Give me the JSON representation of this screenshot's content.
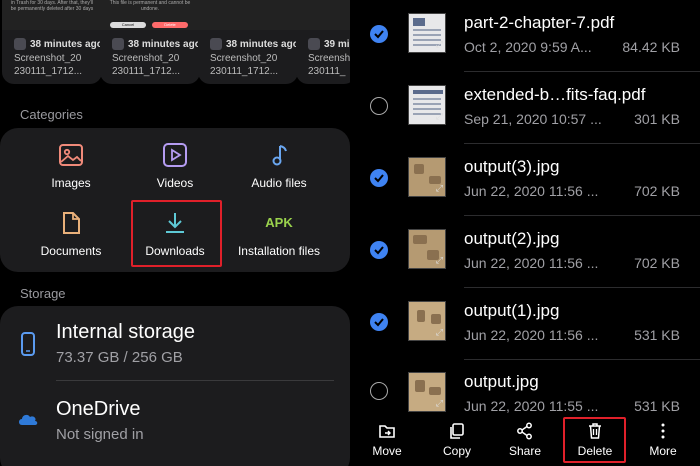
{
  "recent": {
    "cards": [
      {
        "message": "in Trash for 30 days. After that, they'll be permanently deleted after 30 days",
        "time": "38 minutes ago",
        "name": "Screenshot_20\n230111_1712..."
      },
      {
        "message": "This file is permanent and cannot be undone.",
        "cancel": "Cancel",
        "delete": "Delete",
        "time": "38 minutes ago",
        "name": "Screenshot_20\n230111_1712..."
      },
      {
        "message": "",
        "time": "38 minutes ago",
        "name": "Screenshot_20\n230111_1712..."
      },
      {
        "message": "",
        "time": "39 minut",
        "name": "Screensh\n230111_"
      }
    ]
  },
  "categories": {
    "label": "Categories",
    "items": [
      {
        "label": "Images",
        "icon": "image-icon"
      },
      {
        "label": "Videos",
        "icon": "video-icon"
      },
      {
        "label": "Audio files",
        "icon": "music-note-icon"
      },
      {
        "label": "Documents",
        "icon": "document-icon"
      },
      {
        "label": "Downloads",
        "icon": "download-icon"
      },
      {
        "label": "Installation files",
        "icon": "apk-icon",
        "icon_text": "APK"
      }
    ]
  },
  "storage": {
    "label": "Storage",
    "items": [
      {
        "title": "Internal storage",
        "subtitle": "73.37 GB / 256 GB",
        "icon": "phone-icon"
      },
      {
        "title": "OneDrive",
        "subtitle": "Not signed in",
        "icon": "cloud-icon"
      }
    ]
  },
  "files": [
    {
      "name": "part-2-chapter-7.pdf",
      "meta": "Oct 2, 2020 9:59 A...",
      "size": "84.42 KB",
      "checked": true,
      "kind": "pdf"
    },
    {
      "name": "extended-b…fits-faq.pdf",
      "meta": "Sep 21, 2020 10:57 ...",
      "size": "301 KB",
      "checked": false,
      "kind": "pdf"
    },
    {
      "name": "output(3).jpg",
      "meta": "Jun 22, 2020 11:56 ...",
      "size": "702 KB",
      "checked": true,
      "kind": "jpg"
    },
    {
      "name": "output(2).jpg",
      "meta": "Jun 22, 2020 11:56 ...",
      "size": "702 KB",
      "checked": true,
      "kind": "jpg"
    },
    {
      "name": "output(1).jpg",
      "meta": "Jun 22, 2020 11:56 ...",
      "size": "531 KB",
      "checked": true,
      "kind": "jpg"
    },
    {
      "name": "output.jpg",
      "meta": "Jun 22, 2020 11:55 ...",
      "size": "531 KB",
      "checked": false,
      "kind": "jpg"
    }
  ],
  "toolbar": {
    "move": "Move",
    "copy": "Copy",
    "share": "Share",
    "delete": "Delete",
    "more": "More"
  },
  "colors": {
    "accent_blue": "#3f83f2",
    "highlight_red": "#e0202a",
    "apk_green": "#9ad24d",
    "card_bg": "#1c1c1e"
  }
}
